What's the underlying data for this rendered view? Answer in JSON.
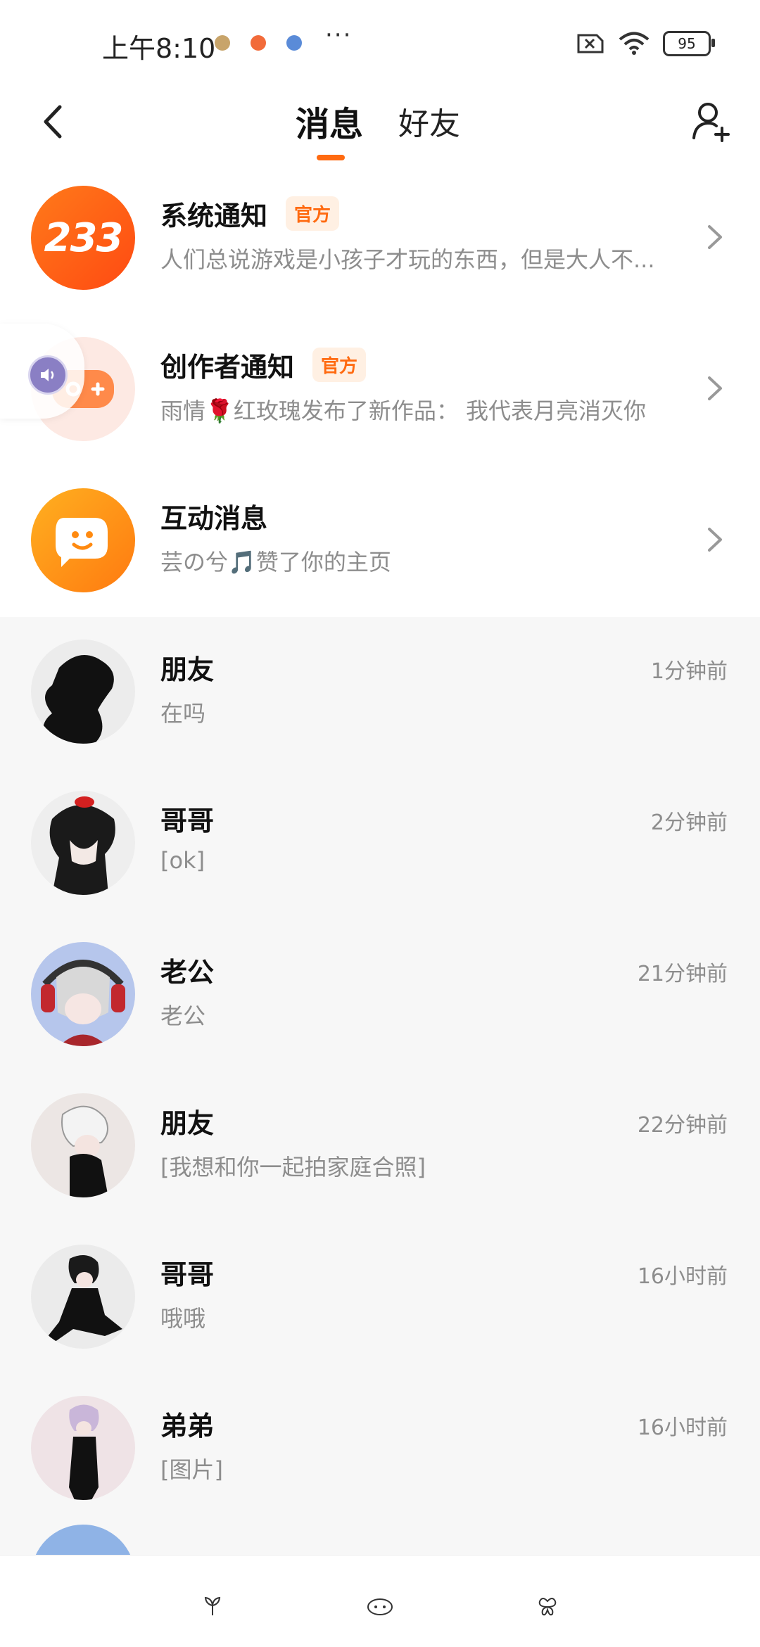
{
  "status_bar": {
    "time": "上午8:10",
    "dots": "···",
    "battery": "95"
  },
  "header": {
    "tabs": [
      {
        "label": "消息"
      },
      {
        "label": "好友"
      }
    ]
  },
  "notifications": [
    {
      "title": "系统通知",
      "badge": "官方",
      "subtitle": "人们总说游戏是小孩子才玩的东西，但是大人不..."
    },
    {
      "title": "创作者通知",
      "badge": "官方",
      "subtitle": "雨情🌹红玫瑰发布了新作品： 我代表月亮消灭你"
    },
    {
      "title": "互动消息",
      "badge": "",
      "subtitle": "芸の兮🎵赞了你的主页"
    }
  ],
  "avatar_text": {
    "system": "233"
  },
  "chats": [
    {
      "name": "朋友",
      "message": "在吗",
      "time": "1分钟前"
    },
    {
      "name": "哥哥",
      "message": "[ok]",
      "time": "2分钟前"
    },
    {
      "name": "老公",
      "message": "老公",
      "time": "21分钟前"
    },
    {
      "name": "朋友",
      "message": "[我想和你一起拍家庭合照]",
      "time": "22分钟前"
    },
    {
      "name": "哥哥",
      "message": "哦哦",
      "time": "16小时前"
    },
    {
      "name": "弟弟",
      "message": "[图片]",
      "time": "16小时前"
    }
  ],
  "colors": {
    "accent": "#ff6a10",
    "badge_bg": "#fff0e3"
  }
}
